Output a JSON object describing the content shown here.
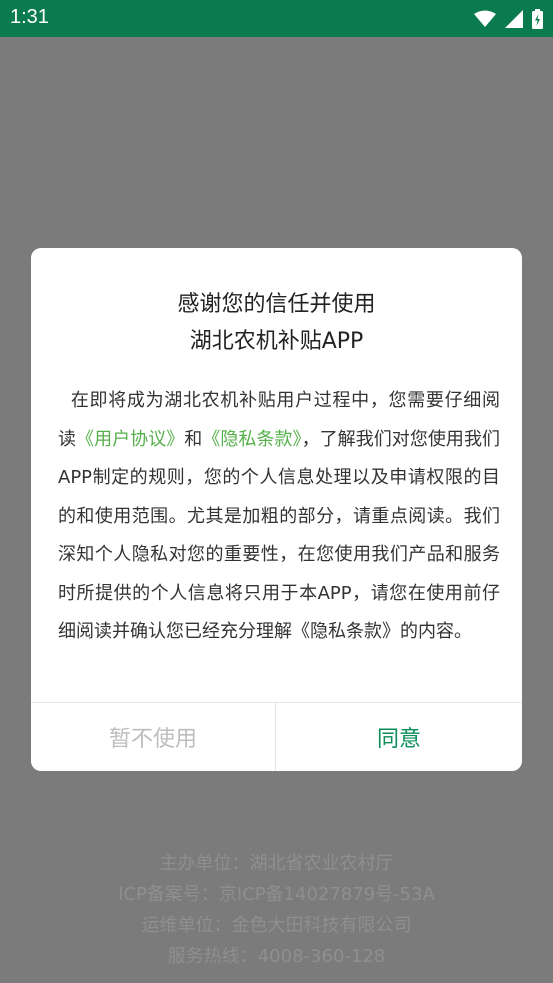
{
  "status_bar": {
    "time": "1:31"
  },
  "footer": {
    "sponsor": "主办单位：湖北省农业农村厅",
    "icp": "ICP备案号：京ICP备14027879号-53A",
    "operator": "运维单位：金色大田科技有限公司",
    "hotline": "服务热线：4008-360-128"
  },
  "dialog": {
    "title_line1": "感谢您的信任并使用",
    "title_line2": "湖北农机补贴APP",
    "body_part1": "在即将成为湖北农机补贴用户过程中，您需要仔细阅读",
    "user_agreement_link": "《用户协议》",
    "body_and": "和",
    "privacy_link": "《隐私条款》",
    "body_part2": "，了解我们对您使用我们APP制定的规则，您的个人信息处理以及申请权限的目的和使用范围。尤其是加粗的部分，请重点阅读。我们深知个人隐私对您的重要性，在您使用我们产品和服务时所提供的个人信息将只用于本APP，请您在使用前仔细阅读并确认您已经充分理解《隐私条款》的内容。",
    "decline_label": "暂不使用",
    "agree_label": "同意"
  },
  "colors": {
    "status_bar": "#0a7a4f",
    "link": "#55b04a",
    "agree": "#0a8d5a",
    "overlay": "#7b7b7b"
  }
}
